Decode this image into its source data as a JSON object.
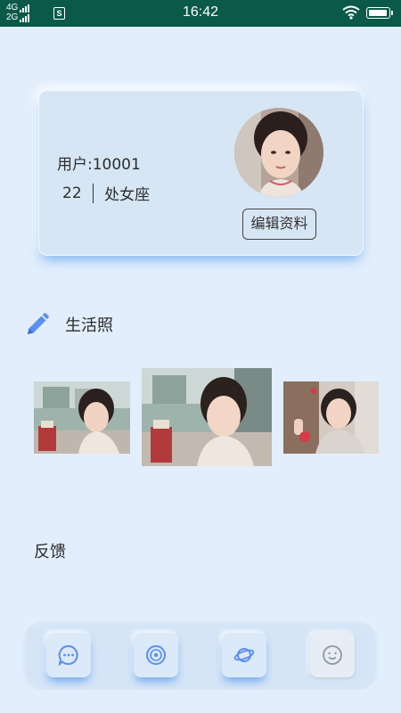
{
  "status_bar": {
    "net_1": "4G",
    "net_2": "2G",
    "sim_icon_letter": "S",
    "time": "16:42",
    "battery_level": 1.0,
    "wifi_icon": "wifi-icon"
  },
  "profile": {
    "user_id": "用户:10001",
    "age": "22",
    "zodiac": "处女座",
    "edit_label": "编辑资料",
    "avatar_icon": "avatar-photo"
  },
  "photos_section": {
    "title": "生活照",
    "icon": "pencil-icon",
    "photos": [
      "photo-1",
      "photo-2",
      "photo-3"
    ]
  },
  "feedback": {
    "label": "反馈"
  },
  "bottom_nav": [
    {
      "icon": "chat-icon",
      "active": true
    },
    {
      "icon": "disc-icon",
      "active": true
    },
    {
      "icon": "planet-icon",
      "active": true
    },
    {
      "icon": "smile-icon",
      "active": false
    }
  ],
  "colors": {
    "status_bar": "#0b5a49",
    "background": "#e2eefb",
    "accent": "#5b8ff0"
  }
}
